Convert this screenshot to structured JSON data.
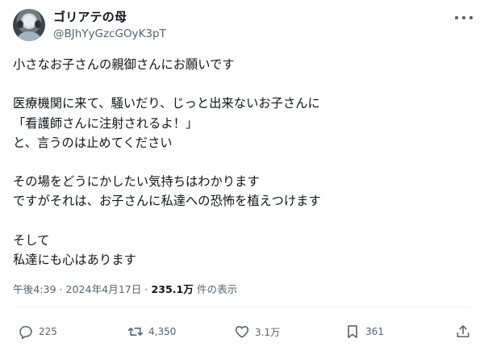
{
  "author": {
    "name": "ゴリアテの母",
    "handle": "@BJhYyGzcGOyK3pT"
  },
  "icons": {
    "avatar": "avatar",
    "more": "more-horizontal-icon",
    "reply": "reply-icon",
    "retweet": "retweet-icon",
    "like": "heart-icon",
    "bookmark": "bookmark-icon",
    "share": "share-icon"
  },
  "post": {
    "lines": [
      "小さなお子さんの親御さんにお願いです",
      "",
      "医療機関に来て、騒いだり、じっと出来ないお子さんに",
      "「看護師さんに注射されるよ！」",
      "と、言うのは止めてください",
      "",
      "その場をどうにかしたい気持ちはわかります",
      "ですがそれは、お子さんに私達への恐怖を植えつけます",
      "",
      "そして",
      "私達にも心はあります"
    ]
  },
  "meta": {
    "time": "午後4:39",
    "separator": "·",
    "date": "2024年4月17日",
    "views": "235.1万",
    "views_label": "件の表示"
  },
  "actions": {
    "reply_count": "225",
    "retweet_count": "4,350",
    "like_count": "3.1万",
    "bookmark_count": "361"
  },
  "colors": {
    "text": "#0f1419",
    "secondary": "#536471",
    "divider": "#eff3f4",
    "background": "#ffffff"
  }
}
